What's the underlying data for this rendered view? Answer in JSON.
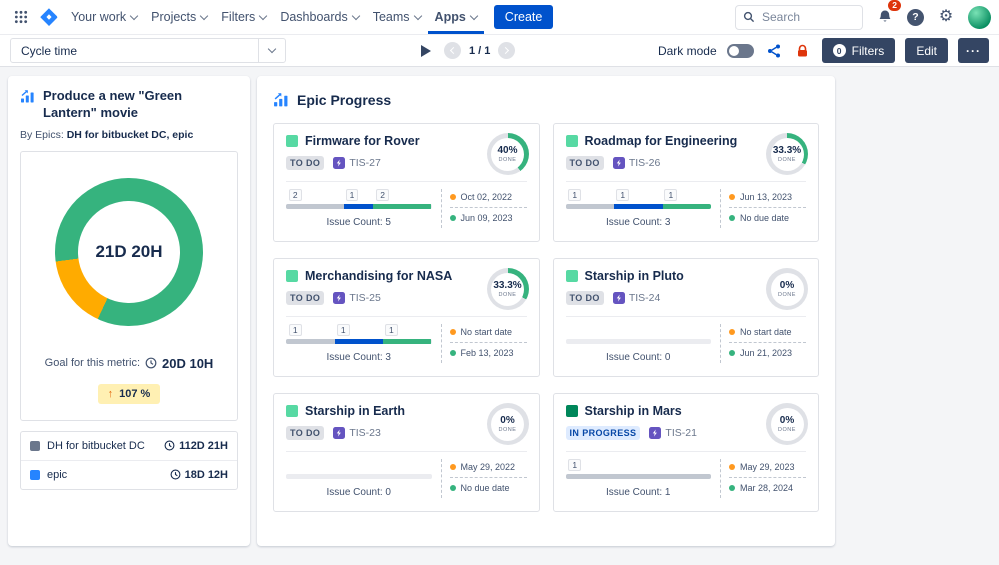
{
  "colors": {
    "done": "#36b37e",
    "in_progress": "#0052cc",
    "todo": "#c1c7d0",
    "track": "#ebecf0",
    "ring_track": "#dfe1e6",
    "over": "#ffab00",
    "start_dot": "#ff991f",
    "due_dot": "#36b37e"
  },
  "nav": {
    "menu": [
      "Your work",
      "Projects",
      "Filters",
      "Dashboards",
      "Teams",
      "Apps"
    ],
    "active_item": "Apps",
    "create_label": "Create",
    "search_placeholder": "Search",
    "notifications_count": "2",
    "help_label": "?"
  },
  "toolbar": {
    "metric_select_value": "Cycle time",
    "page_indicator": "1 / 1",
    "dark_mode_label": "Dark mode",
    "filters_label": "Filters",
    "filters_count": "0",
    "edit_label": "Edit",
    "more_label": "···"
  },
  "left_panel": {
    "title": "Produce a new \"Green Lantern\" movie",
    "subtitle_label": "By Epics:",
    "subtitle_value": "DH for bitbucket DC, epic",
    "donut_center": "21D 20H",
    "donut_over_pct": 16,
    "goal_label": "Goal for this metric:",
    "goal_value": "20D 10H",
    "delta_value": "107 %",
    "legend": [
      {
        "label": "DH for bitbucket DC",
        "value": "112D 21H",
        "color": "#6b778c"
      },
      {
        "label": "epic",
        "value": "18D 12H",
        "color": "#2684ff"
      }
    ]
  },
  "right_panel": {
    "title": "Epic Progress",
    "done_label": "DONE",
    "cards": [
      {
        "name": "Firmware for Rover",
        "icon_color": "#57d9a3",
        "status": "TO DO",
        "status_type": "todo",
        "key": "TIS-27",
        "percent_label": "40%",
        "percent": 40,
        "segments": [
          {
            "type": "todo",
            "pct": 40
          },
          {
            "type": "in_progress",
            "pct": 20
          },
          {
            "type": "done",
            "pct": 40
          }
        ],
        "chips": [
          {
            "label": "2",
            "pos": 2
          },
          {
            "label": "1",
            "pos": 41
          },
          {
            "label": "2",
            "pos": 62
          }
        ],
        "issue_count": "Issue Count: 5",
        "start_date": "Oct 02, 2022",
        "due_date": "Jun 09, 2023"
      },
      {
        "name": "Roadmap for Engineering",
        "icon_color": "#57d9a3",
        "status": "TO DO",
        "status_type": "todo",
        "key": "TIS-26",
        "percent_label": "33.3%",
        "percent": 33.3,
        "segments": [
          {
            "type": "todo",
            "pct": 33.4
          },
          {
            "type": "in_progress",
            "pct": 33.3
          },
          {
            "type": "done",
            "pct": 33.3
          }
        ],
        "chips": [
          {
            "label": "1",
            "pos": 2
          },
          {
            "label": "1",
            "pos": 35
          },
          {
            "label": "1",
            "pos": 68
          }
        ],
        "issue_count": "Issue Count: 3",
        "start_date": "Jun 13, 2023",
        "due_date": "No due date"
      },
      {
        "name": "Merchandising for NASA",
        "icon_color": "#57d9a3",
        "status": "TO DO",
        "status_type": "todo",
        "key": "TIS-25",
        "percent_label": "33.3%",
        "percent": 33.3,
        "segments": [
          {
            "type": "todo",
            "pct": 33.4
          },
          {
            "type": "in_progress",
            "pct": 33.3
          },
          {
            "type": "done",
            "pct": 33.3
          }
        ],
        "chips": [
          {
            "label": "1",
            "pos": 2
          },
          {
            "label": "1",
            "pos": 35
          },
          {
            "label": "1",
            "pos": 68
          }
        ],
        "issue_count": "Issue Count: 3",
        "start_date": "No start date",
        "due_date": "Feb 13, 2023"
      },
      {
        "name": "Starship in Pluto",
        "icon_color": "#57d9a3",
        "status": "TO DO",
        "status_type": "todo",
        "key": "TIS-24",
        "percent_label": "0%",
        "percent": 0,
        "segments": [],
        "chips": [],
        "issue_count": "Issue Count: 0",
        "start_date": "No start date",
        "due_date": "Jun 21, 2023"
      },
      {
        "name": "Starship in Earth",
        "icon_color": "#57d9a3",
        "status": "TO DO",
        "status_type": "todo",
        "key": "TIS-23",
        "percent_label": "0%",
        "percent": 0,
        "segments": [],
        "chips": [],
        "issue_count": "Issue Count: 0",
        "start_date": "May 29, 2022",
        "due_date": "No due date"
      },
      {
        "name": "Starship in Mars",
        "icon_color": "#00875a",
        "status": "IN PROGRESS",
        "status_type": "inprogress",
        "key": "TIS-21",
        "percent_label": "0%",
        "percent": 0,
        "segments": [
          {
            "type": "todo",
            "pct": 100
          }
        ],
        "chips": [
          {
            "label": "1",
            "pos": 2
          }
        ],
        "issue_count": "Issue Count: 1",
        "start_date": "May 29, 2023",
        "due_date": "Mar 28, 2024"
      }
    ]
  }
}
